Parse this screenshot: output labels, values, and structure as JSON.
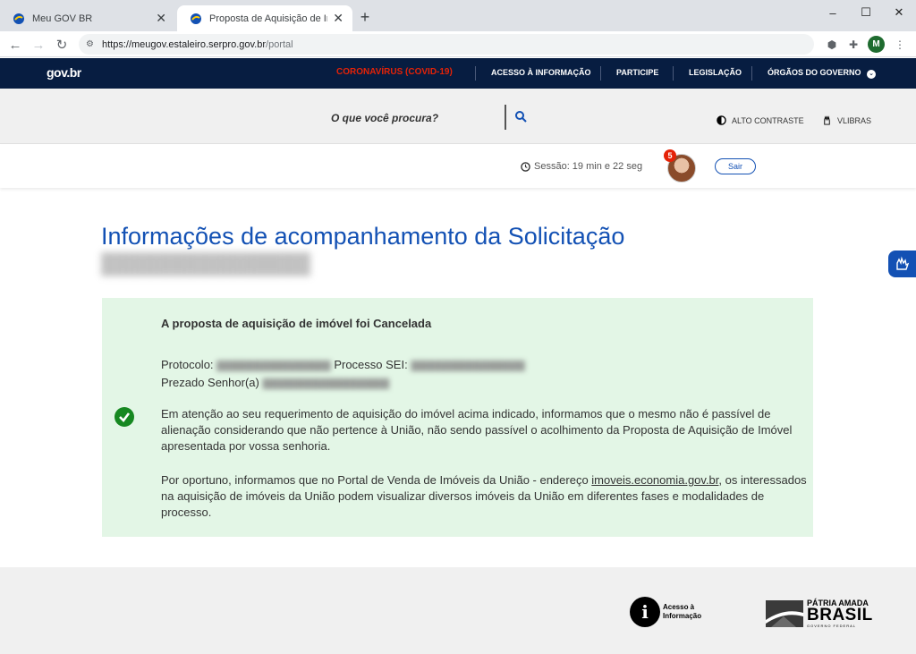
{
  "browser": {
    "tabs": [
      {
        "title": "Meu GOV BR",
        "active": false
      },
      {
        "title": "Proposta de Aquisição de Imóvel",
        "active": true
      }
    ],
    "new_tab": "+",
    "url_host": "https://meugov.estaleiro.serpro.gov.br",
    "url_path": "/portal",
    "profile_initial": "M",
    "window_controls": [
      "–",
      "☐",
      "✕"
    ]
  },
  "header": {
    "logo": "gov.br",
    "nav": [
      "CORONAVÍRUS (COVID-19)",
      "ACESSO À INFORMAÇÃO",
      "PARTICIPE",
      "LEGISLAÇÃO",
      "ÓRGÃOS DO GOVERNO"
    ],
    "search_placeholder": "O que você procura?",
    "high_contrast": "ALTO CONTRASTE",
    "vlibras": "VLIBRAS"
  },
  "session": {
    "label": "Sessão: 19 min e 22 seg",
    "notifications": "5",
    "logout": "Sair"
  },
  "main": {
    "title": "Informações de acompanhamento da Solicitação",
    "alert": {
      "heading": "A proposta de aquisição de imóvel foi Cancelada",
      "protocolo_label": "Protocolo:",
      "processo_label": "Processo SEI:",
      "prezado_label": "Prezado Senhor(a)",
      "paragraph1": "Em atenção ao seu requerimento de aquisição do imóvel acima indicado, informamos que o mesmo não é passível de alienação considerando que não pertence à União, não sendo passível o acolhimento da Proposta de Aquisição de Imóvel apresentada por vossa senhoria.",
      "paragraph2_before": "Por oportuno, informamos que no Portal de Venda de Imóveis da União - endereço ",
      "paragraph2_link": "imoveis.economia.gov.br",
      "paragraph2_after": ", os interessados na aquisição de imóveis da União podem visualizar diversos imóveis da União em diferentes fases e modalidades de processo."
    }
  },
  "footer": {
    "acesso_line1": "Acesso à",
    "acesso_line2": "Informação",
    "patria_line1": "PÁTRIA AMADA",
    "patria_line2": "BRASIL",
    "patria_line3": "GOVERNO FEDERAL"
  },
  "colors": {
    "gov_blue": "#071d41",
    "link_blue": "#1351b4",
    "covid_red": "#e52207",
    "success_bg": "#e3f6e6",
    "success_green": "#168821"
  }
}
